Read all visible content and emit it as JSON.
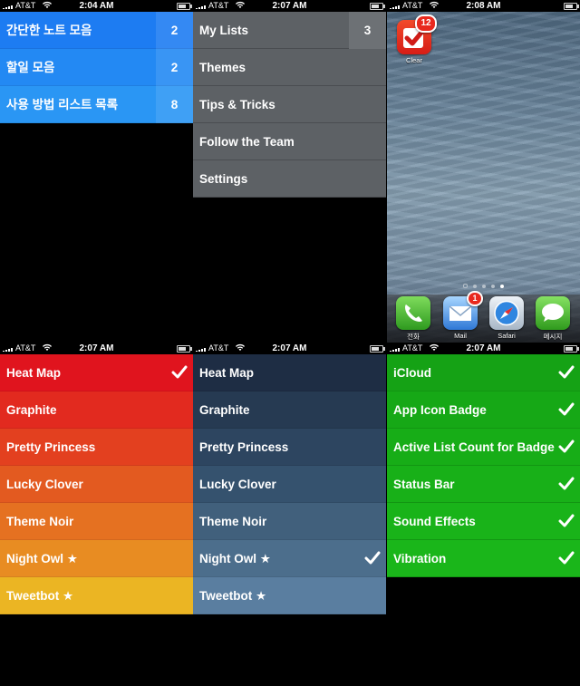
{
  "screens": {
    "s1": {
      "time": "2:04 AM",
      "carrier": "AT&T",
      "lists": [
        {
          "label": "간단한 노트 모음",
          "count": "2"
        },
        {
          "label": "할일 모음",
          "count": "2"
        },
        {
          "label": "사용 방법 리스트 목록",
          "count": "8"
        }
      ]
    },
    "s2": {
      "time": "2:07 AM",
      "carrier": "AT&T",
      "menu": [
        {
          "label": "My Lists",
          "count": "3"
        },
        {
          "label": "Themes"
        },
        {
          "label": "Tips & Tricks"
        },
        {
          "label": "Follow the Team"
        },
        {
          "label": "Settings"
        }
      ]
    },
    "s3": {
      "time": "2:08 AM",
      "carrier": "AT&T",
      "app": {
        "label": "Clear",
        "badge": "12"
      },
      "dock": [
        {
          "label": "전화",
          "icon": "phone-icon"
        },
        {
          "label": "Mail",
          "icon": "mail-icon",
          "badge": "1"
        },
        {
          "label": "Safari",
          "icon": "safari-icon"
        },
        {
          "label": "메시지",
          "icon": "messages-icon"
        }
      ]
    },
    "s4": {
      "time": "2:07 AM",
      "carrier": "AT&T",
      "themes": [
        {
          "label": "Heat Map",
          "checked": true
        },
        {
          "label": "Graphite"
        },
        {
          "label": "Pretty Princess"
        },
        {
          "label": "Lucky Clover"
        },
        {
          "label": "Theme Noir"
        },
        {
          "label": "Night Owl ★"
        },
        {
          "label": "Tweetbot ★"
        }
      ]
    },
    "s5": {
      "time": "2:07 AM",
      "carrier": "AT&T",
      "themes": [
        {
          "label": "Heat Map"
        },
        {
          "label": "Graphite"
        },
        {
          "label": "Pretty Princess"
        },
        {
          "label": "Lucky Clover"
        },
        {
          "label": "Theme Noir"
        },
        {
          "label": "Night Owl ★",
          "checked": true
        },
        {
          "label": "Tweetbot ★"
        }
      ]
    },
    "s6": {
      "time": "2:07 AM",
      "carrier": "AT&T",
      "settings": [
        {
          "label": "iCloud",
          "checked": true
        },
        {
          "label": "App Icon Badge",
          "checked": true
        },
        {
          "label": "Active List Count for Badge",
          "checked": true
        },
        {
          "label": "Status Bar",
          "checked": true
        },
        {
          "label": "Sound Effects",
          "checked": true
        },
        {
          "label": "Vibration",
          "checked": true
        }
      ]
    }
  }
}
